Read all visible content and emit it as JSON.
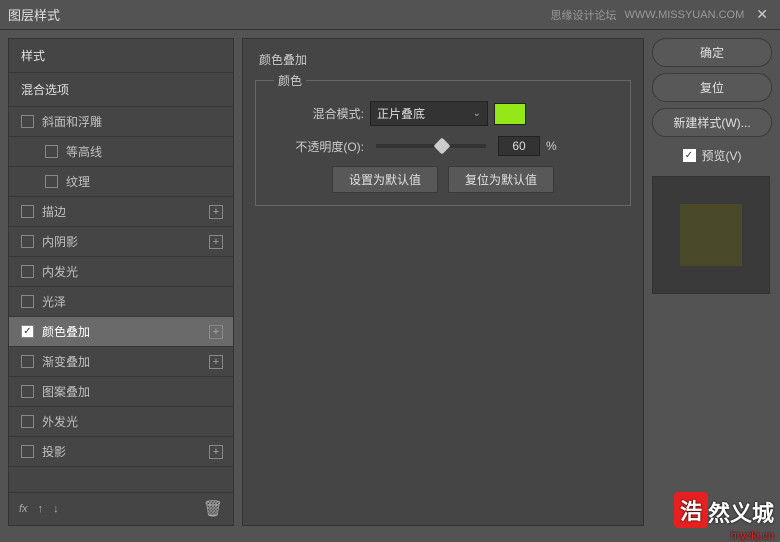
{
  "title_bar": {
    "title": "图层样式",
    "forum": "思缘设计论坛",
    "forum_url": "WWW.MISSYUAN.COM"
  },
  "styles_panel": {
    "header": "样式",
    "blend_options": "混合选项",
    "items": [
      {
        "label": "斜面和浮雕",
        "checked": false,
        "addable": false,
        "indent": false
      },
      {
        "label": "等高线",
        "checked": false,
        "addable": false,
        "indent": true
      },
      {
        "label": "纹理",
        "checked": false,
        "addable": false,
        "indent": true
      },
      {
        "label": "描边",
        "checked": false,
        "addable": true,
        "indent": false
      },
      {
        "label": "内阴影",
        "checked": false,
        "addable": true,
        "indent": false
      },
      {
        "label": "内发光",
        "checked": false,
        "addable": false,
        "indent": false
      },
      {
        "label": "光泽",
        "checked": false,
        "addable": false,
        "indent": false
      },
      {
        "label": "颜色叠加",
        "checked": true,
        "addable": true,
        "indent": false,
        "selected": true
      },
      {
        "label": "渐变叠加",
        "checked": false,
        "addable": true,
        "indent": false
      },
      {
        "label": "图案叠加",
        "checked": false,
        "addable": false,
        "indent": false
      },
      {
        "label": "外发光",
        "checked": false,
        "addable": false,
        "indent": false
      },
      {
        "label": "投影",
        "checked": false,
        "addable": true,
        "indent": false
      }
    ],
    "footer_fx": "fx"
  },
  "settings": {
    "group_title": "颜色叠加",
    "sub_group_title": "颜色",
    "blend_mode_label": "混合模式:",
    "blend_mode_value": "正片叠底",
    "color_hex": "#94e817",
    "opacity_label": "不透明度(O):",
    "opacity_value": "60",
    "opacity_unit": "%",
    "set_default": "设置为默认值",
    "reset_default": "复位为默认值"
  },
  "right_panel": {
    "ok": "确定",
    "cancel": "复位",
    "new_style": "新建样式(W)...",
    "preview": "预览(V)"
  },
  "watermark": {
    "badge": "浩",
    "text": "然义城",
    "url": "hryckj.cn"
  }
}
